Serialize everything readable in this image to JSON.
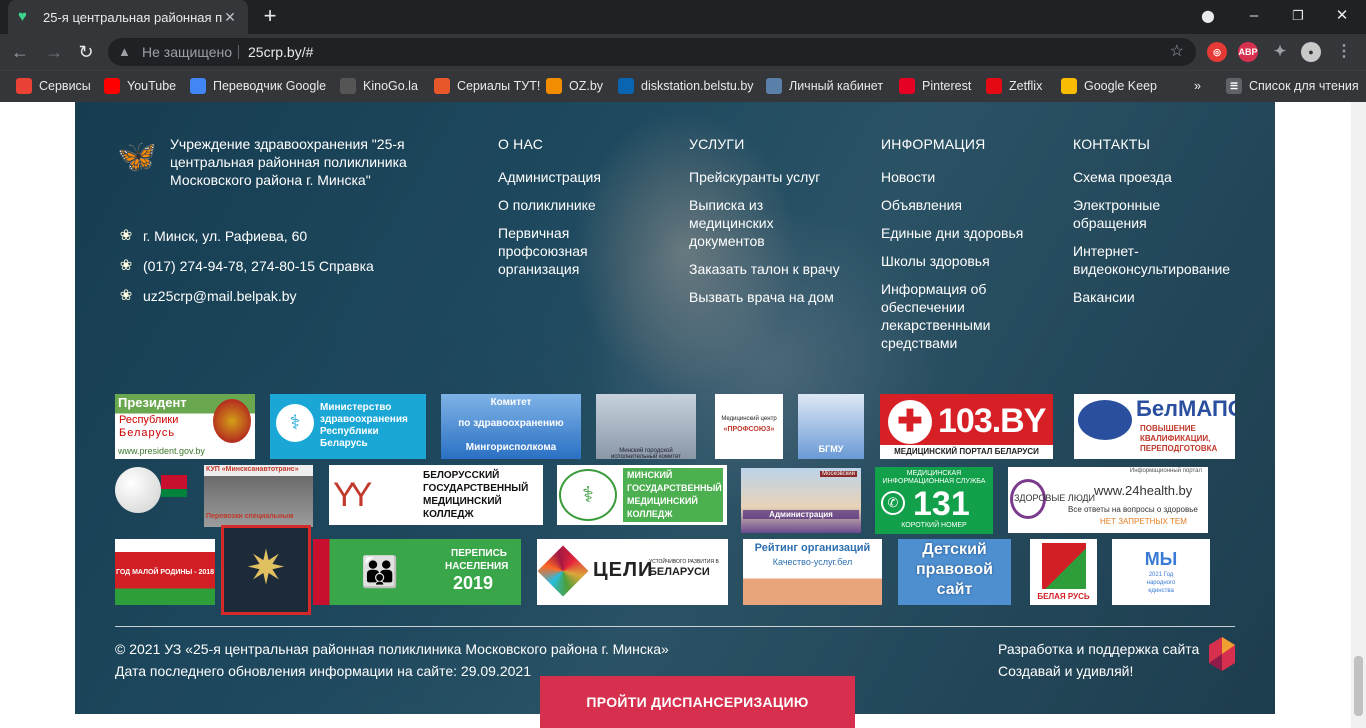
{
  "browser": {
    "tab_title": "25-я центральная районная пол",
    "not_secure": "Не защищено",
    "url": "25crp.by/#",
    "ext_abp": "ABP"
  },
  "bookmarks": [
    {
      "label": "Сервисы",
      "color": "#ea4335"
    },
    {
      "label": "YouTube",
      "color": "#ff0000"
    },
    {
      "label": "Переводчик Google",
      "color": "#4285f4"
    },
    {
      "label": "KinoGo.la",
      "color": "#555555"
    },
    {
      "label": "Сериалы ТУТ!",
      "color": "#e8572a"
    },
    {
      "label": "OZ.by",
      "color": "#f28c00"
    },
    {
      "label": "diskstation.belstu.by",
      "color": "#0a65b0"
    },
    {
      "label": "Личный кабинет",
      "color": "#5a7fa8"
    },
    {
      "label": "Pinterest",
      "color": "#e60023"
    },
    {
      "label": "Zetflix",
      "color": "#e50914"
    },
    {
      "label": "Google Keep",
      "color": "#fbbc04"
    }
  ],
  "reading_list": "Список для чтения",
  "footer": {
    "org_name": "Учреждение здравоохранения \"25-я центральная районная поликлиника Московского района г. Минска\"",
    "address": "г. Минск, ул. Рафиева, 60",
    "phone": "(017) 274-94-78, 274-80-15 Справка",
    "email": "uz25crp@mail.belpak.by",
    "columns": [
      {
        "title": "О НАС",
        "links": [
          "Администрация",
          "О поликлинике",
          "Первичная профсоюзная организация"
        ]
      },
      {
        "title": "УСЛУГИ",
        "links": [
          "Прейскуранты услуг",
          "Выписка из медицинских документов",
          "Заказать талон к врачу",
          "Вызвать врача на дом"
        ]
      },
      {
        "title": "ИНФОРМАЦИЯ",
        "links": [
          "Новости",
          "Объявления",
          "Единые дни здоровья",
          "Школы здоровья",
          "Информация об обеспечении лекарственными средствами"
        ]
      },
      {
        "title": "КОНТАКТЫ",
        "links": [
          "Схема проезда",
          "Электронные обращения",
          "Интернет-видеоконсультирование",
          "Вакансии"
        ]
      }
    ],
    "banners": {
      "president_1": "Президент",
      "president_2": "Республики",
      "president_3": "Беларусь",
      "president_url": "www.president.gov.by",
      "minzdrav_1": "Министерство",
      "minzdrav_2": "здравоохранения",
      "minzdrav_3": "Республики",
      "minzdrav_4": "Беларусь",
      "komitet_1": "Комитет",
      "komitet_2": "по здравоохранению",
      "komitet_3": "Мингорисполкома",
      "mgik": "Минский городской исполнительный комитет",
      "profsoyuz_1": "Медицинский центр",
      "profsoyuz_2": "«ПРОФСОЮЗ»",
      "bgmu": "БГМУ",
      "b103": "103.BY",
      "b103_sub": "МЕДИЦИНСКИЙ ПОРТАЛ БЕЛАРУСИ",
      "belmapo": "БелМАПО",
      "belmapo_1": "ПОВЫШЕНИЕ",
      "belmapo_2": "КВАЛИФИКАЦИИ,",
      "belmapo_3": "ПЕРЕПОДГОТОВКА",
      "sanavto_1": "КУП «Минсксанавтотранс»",
      "sanavto_2": "Перевозки специальным",
      "bgmk_1": "БЕЛОРУССКИЙ",
      "bgmk_2": "ГОСУДАРСТВЕННЫЙ",
      "bgmk_3": "МЕДИЦИНСКИЙ",
      "bgmk_4": "КОЛЛЕДЖ",
      "mgmk_1": "МИНСКИЙ",
      "mgmk_2": "ГОСУДАРСТВЕННЫЙ",
      "mgmk_3": "МЕДИЦИНСКИЙ",
      "mgmk_4": "КОЛЛЕДЖ",
      "admin_1": "Московский",
      "admin_2": "Администрация",
      "b131_1": "МЕДИЦИНСКАЯ",
      "b131_2": "ИНФОРМАЦИОННАЯ СЛУЖБА",
      "b131": "131",
      "b131_3": "КОРОТКИЙ НОМЕР",
      "h24_head": "Информационный портал",
      "h24_1": "ЗДОРОВЫЕ ЛЮДИ",
      "h24_url": "www.24health.by",
      "h24_2": "Все ответы на вопросы о здоровье",
      "h24_3": "НЕТ ЗАПРЕТНЫХ ТЕМ",
      "godrodiny": "ГОД МАЛОЙ РОДИНЫ - 2018",
      "perepis_1": "ПЕРЕПИСЬ",
      "perepis_2": "НАСЕЛЕНИЯ",
      "perepis_3": "2019",
      "celi_1": "ЦЕЛИ",
      "celi_2": "УСТОЙЧИВОГО РАЗВИТИЯ В",
      "celi_3": "БЕЛАРУСИ",
      "reiting_1": "Рейтинг организаций",
      "reiting_2": "Качество-услуг.бел",
      "detsky_1": "Детский",
      "detsky_2": "правовой",
      "detsky_3": "сайт",
      "belrus": "БЕЛАЯ РУСЬ",
      "my_1": "МЫ",
      "my_2": "2021 Год",
      "my_3": "народного",
      "my_4": "единства"
    },
    "copyright": "© 2021 УЗ «25-я центральная районная поликлиника Московского района г. Минска»",
    "updated": "Дата последнего обновления информации на сайте: 29.09.2021",
    "dev_1": "Разработка и поддержка сайта",
    "dev_2": "Создавай и удивляй!",
    "cta": "ПРОЙТИ ДИСПАНСЕРИЗАЦИЮ"
  }
}
